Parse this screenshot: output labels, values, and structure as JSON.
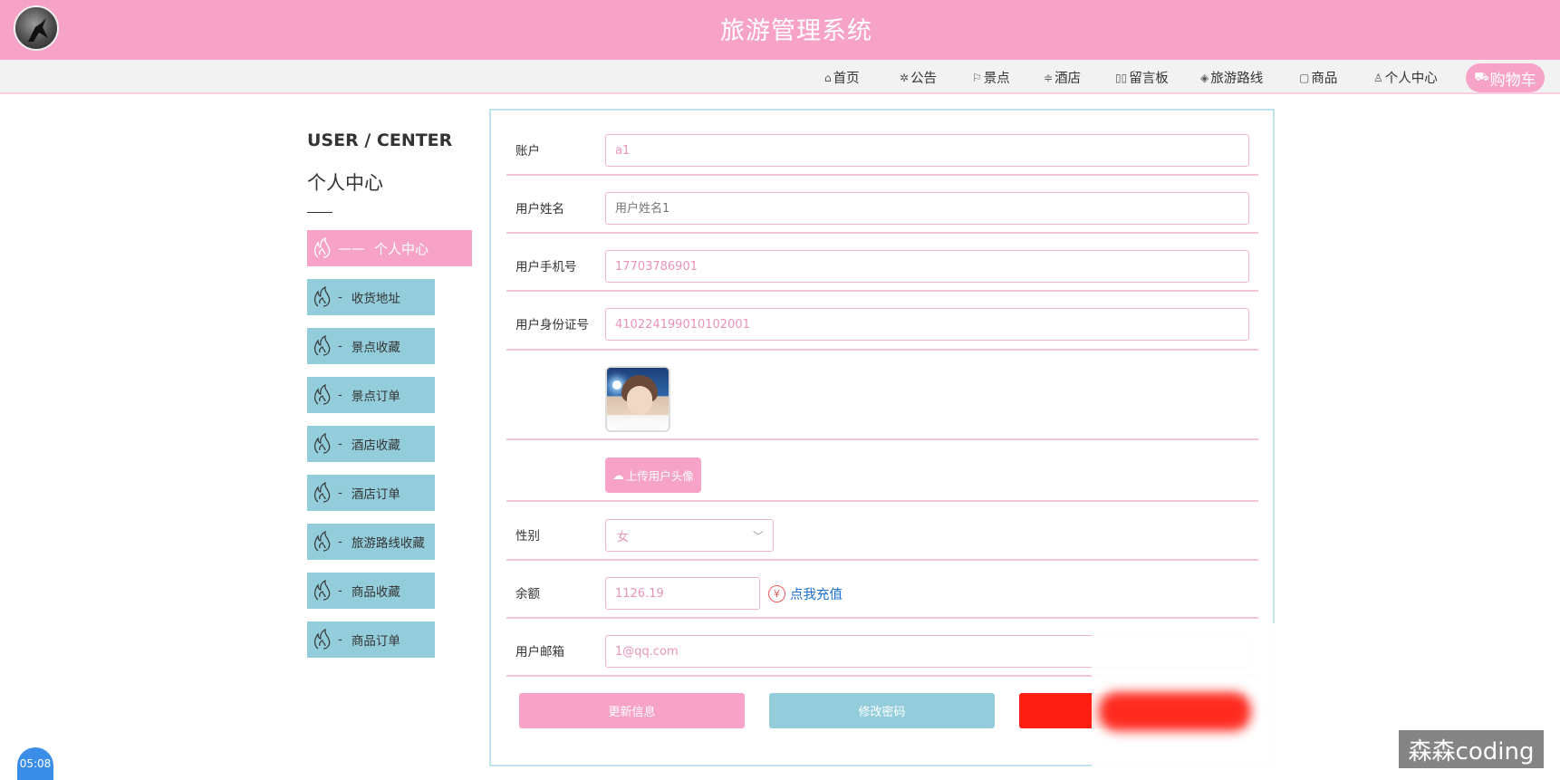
{
  "header": {
    "title": "旅游管理系统"
  },
  "nav": {
    "items": [
      {
        "label": "首页",
        "icon": "home-icon",
        "glyph": "⌂"
      },
      {
        "label": "公告",
        "icon": "gear-icon",
        "glyph": "✲"
      },
      {
        "label": "景点",
        "icon": "flag-icon",
        "glyph": "⚐"
      },
      {
        "label": "酒店",
        "icon": "sliders-icon",
        "glyph": "≑"
      },
      {
        "label": "留言板",
        "icon": "book-icon",
        "glyph": "▯▯"
      },
      {
        "label": "旅游路线",
        "icon": "layers-icon",
        "glyph": "◈"
      },
      {
        "label": "商品",
        "icon": "clipboard-icon",
        "glyph": "▢"
      },
      {
        "label": "个人中心",
        "icon": "user-icon",
        "glyph": "♙"
      }
    ],
    "cart": {
      "label": "购物车",
      "icon": "cart-icon",
      "glyph": "⛟"
    }
  },
  "sidebar": {
    "title_en": "USER / CENTER",
    "title_cn": "个人中心",
    "active": {
      "dash": "——",
      "label": "个人中心"
    },
    "items": [
      {
        "dash": "-",
        "label": "收货地址"
      },
      {
        "dash": "-",
        "label": "景点收藏"
      },
      {
        "dash": "-",
        "label": "景点订单"
      },
      {
        "dash": "-",
        "label": "酒店收藏"
      },
      {
        "dash": "-",
        "label": "酒店订单"
      },
      {
        "dash": "-",
        "label": "旅游路线收藏"
      },
      {
        "dash": "-",
        "label": "商品收藏"
      },
      {
        "dash": "-",
        "label": "商品订单"
      }
    ]
  },
  "form": {
    "account": {
      "label": "账户",
      "value": "a1"
    },
    "name": {
      "label": "用户姓名",
      "value": "用户姓名1"
    },
    "phone": {
      "label": "用户手机号",
      "value": "17703786901"
    },
    "idcard": {
      "label": "用户身份证号",
      "value": "410224199010102001"
    },
    "upload_label": "上传用户头像",
    "gender": {
      "label": "性别",
      "value": "女"
    },
    "balance": {
      "label": "余额",
      "value": "1126.19",
      "recharge_label": "点我充值",
      "currency_glyph": "¥"
    },
    "email": {
      "label": "用户邮箱",
      "value": "1@qq.com"
    },
    "buttons": {
      "update": "更新信息",
      "password": "修改密码"
    }
  },
  "colors": {
    "accent_pink": "#f7a3c8",
    "accent_blue": "#93cddb",
    "danger_red": "#ff1e12",
    "link_blue": "#1a6fcc"
  },
  "overlay": {
    "watermark": "森森coding",
    "timer": "05:08"
  }
}
